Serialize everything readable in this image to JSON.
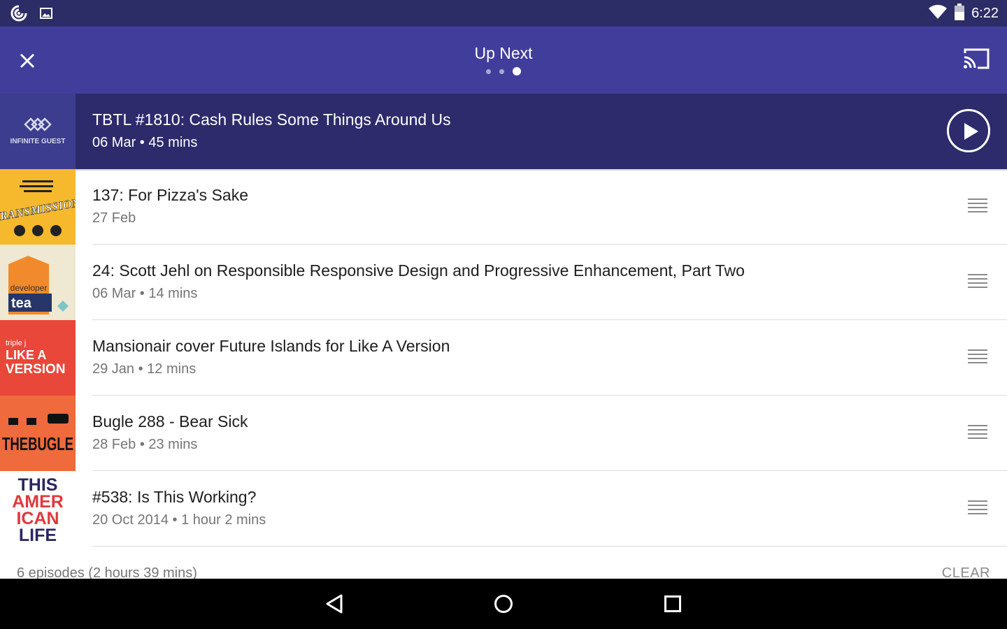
{
  "status_bar": {
    "time": "6:22"
  },
  "toolbar": {
    "title": "Up Next",
    "page_count": 3,
    "active_page": 3
  },
  "now_playing": {
    "podcast": "INFINITE GUEST",
    "title": "TBTL #1810: Cash Rules Some Things Around Us",
    "meta": "06 Mar • 45 mins"
  },
  "queue": [
    {
      "title": "137: For Pizza's Sake",
      "meta": "27 Feb",
      "artwork": "transmission",
      "art_text": "TRANSMISSION"
    },
    {
      "title": "24: Scott Jehl on Responsible Responsive Design and Progressive Enhancement, Part Two",
      "meta": "06 Mar • 14 mins",
      "artwork": "developer-tea",
      "art_text": "developer",
      "art_text2": "tea"
    },
    {
      "title": "Mansionair cover Future Islands for Like A Version",
      "meta": "29 Jan • 12 mins",
      "artwork": "like-a-version",
      "art_text": "triple j",
      "art_text2": "LIKE A",
      "art_text3": "VERSION"
    },
    {
      "title": "Bugle 288 - Bear Sick",
      "meta": "28 Feb • 23 mins",
      "artwork": "the-bugle",
      "art_text": "THEBUGLE"
    },
    {
      "title": "#538: Is This Working?",
      "meta": "20 Oct 2014 • 1 hour 2 mins",
      "artwork": "this-american-life",
      "art_lines": [
        "THIS",
        "AMER",
        "ICAN",
        "LIFE"
      ]
    }
  ],
  "footer": {
    "summary": "6 episodes (2 hours 39 mins)",
    "clear_label": "CLEAR"
  },
  "colors": {
    "status_bar": "#2c2c66",
    "toolbar": "#413e9b",
    "now_playing_bg": "#2d2b6b"
  }
}
